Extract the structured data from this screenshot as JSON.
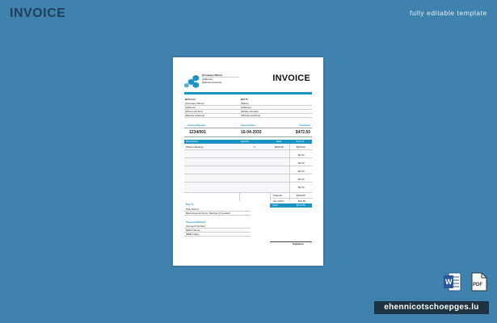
{
  "header": {
    "title": "INVOICE",
    "tagline": "fully editable template"
  },
  "invoice": {
    "title": "INVOICE",
    "company_name": "[Company Name]",
    "company_address": "[Address]",
    "company_website": "[Website Address]",
    "bill_from": {
      "label": "Bill From",
      "lines": [
        "[Company Name]",
        "[Address]",
        "[Phone Number]",
        "[Website Address]"
      ]
    },
    "bill_to": {
      "label": "Bill To",
      "lines": [
        "[Name]",
        "[Address]",
        "[Mobile Number]",
        "[Website Address]"
      ]
    },
    "meta_labels": [
      "Invoice Number",
      "Invoice Date",
      "Total Due"
    ],
    "meta_values": [
      "1234/001",
      "15-04-2033",
      "$472.50"
    ],
    "table_headers": [
      "Description",
      "Qty/Hrs",
      "Rate",
      "Amount"
    ],
    "items": [
      {
        "description": "Partner Meeting",
        "qty": "2",
        "rate": "$220.00",
        "amount": "$450.00"
      }
    ],
    "empty_amounts": [
      "$0.00",
      "$0.00",
      "$0.00",
      "$0.00",
      "$0.00"
    ],
    "subtotal_label": "Subtotal",
    "subtotal_value": "$450.00",
    "tax_label": "Tax (20%)",
    "tax_value": "$22.50",
    "total_label": "Total",
    "total_value": "$472.50",
    "pay_to_label": "Pay To",
    "pay_to_lines": [
      "[Pay Name]",
      "Bank Account Name: Number (if needed)"
    ],
    "payment_method_label": "Payment Method",
    "payment_lines": [
      "[Account Number]",
      "[Bank Name]",
      "[BSB Code]"
    ],
    "signature_label": "Signature"
  },
  "downloads": {
    "word_icon": "word-file-icon",
    "pdf_icon": "pdf-file-icon",
    "word_letter": "W",
    "pdf_text": "PDF"
  },
  "site": "ehennicotschoepges.lu",
  "colors": {
    "background": "#3f82ad",
    "accent": "#1a93c6",
    "word": "#2b5797",
    "pdf": "#e9e9e9"
  }
}
